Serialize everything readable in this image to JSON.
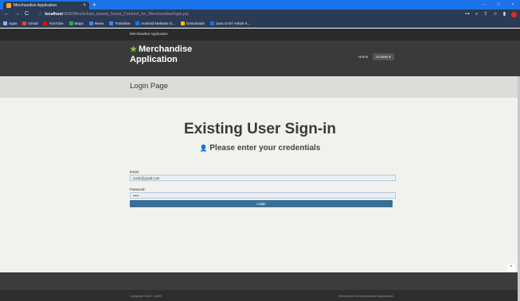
{
  "browser": {
    "tab_title": "Merchandise Application",
    "tab_close": "×",
    "new_tab": "+",
    "window_controls": [
      "–",
      "□",
      "×"
    ],
    "nav": {
      "back": "←",
      "forward": "→",
      "reload": "C"
    },
    "url": {
      "lock": "ⓘ",
      "host": "localhost",
      "path": ":8080/Blockchain_based_Smart_Contract_for_Merchandise/login.jsp"
    },
    "toolbar_icons": [
      "⊶",
      "⌕",
      "⇪",
      "☆",
      "▮"
    ],
    "bookmarks": [
      {
        "label": "Apps",
        "color": "#8ab4f8"
      },
      {
        "label": "Gmail",
        "color": "#ea4335"
      },
      {
        "label": "YouTube",
        "color": "#ff0000"
      },
      {
        "label": "Maps",
        "color": "#34a853"
      },
      {
        "label": "News",
        "color": "#4285f4"
      },
      {
        "label": "Translate",
        "color": "#4285f4"
      },
      {
        "label": "Android Malware D...",
        "color": "#1a73e8"
      },
      {
        "label": "Downloads",
        "color": "#fbbc04"
      },
      {
        "label": "Java Unit7 Ashok K...",
        "color": "#1a73e8"
      }
    ]
  },
  "site": {
    "top_brand": "Merchandise Application",
    "logo_star": "★",
    "logo_line1": "Merchandise",
    "logo_line2": "Application",
    "menu": {
      "home": "Home",
      "access": "Access ▾"
    },
    "page_title": "Login Page"
  },
  "login": {
    "heading": "Existing User Sign-in",
    "subheading_icon": "👤",
    "subheading": "Please enter your credentials",
    "email_label": "Email:",
    "email_value": "mail1@gmail.com",
    "password_label": "Password:",
    "password_value": "•••••",
    "login_button": "Login"
  },
  "footer": {
    "copyright": "Copyright 2022. (c)MS",
    "developed": "Developed by Merchandise Application",
    "scroll_top": "^"
  },
  "colors": {
    "chrome_tabstrip": "#1a73e8",
    "chrome_toolbar": "#2b3a55",
    "navbar": "#3a3a3a",
    "login_button": "#3a6f93"
  }
}
